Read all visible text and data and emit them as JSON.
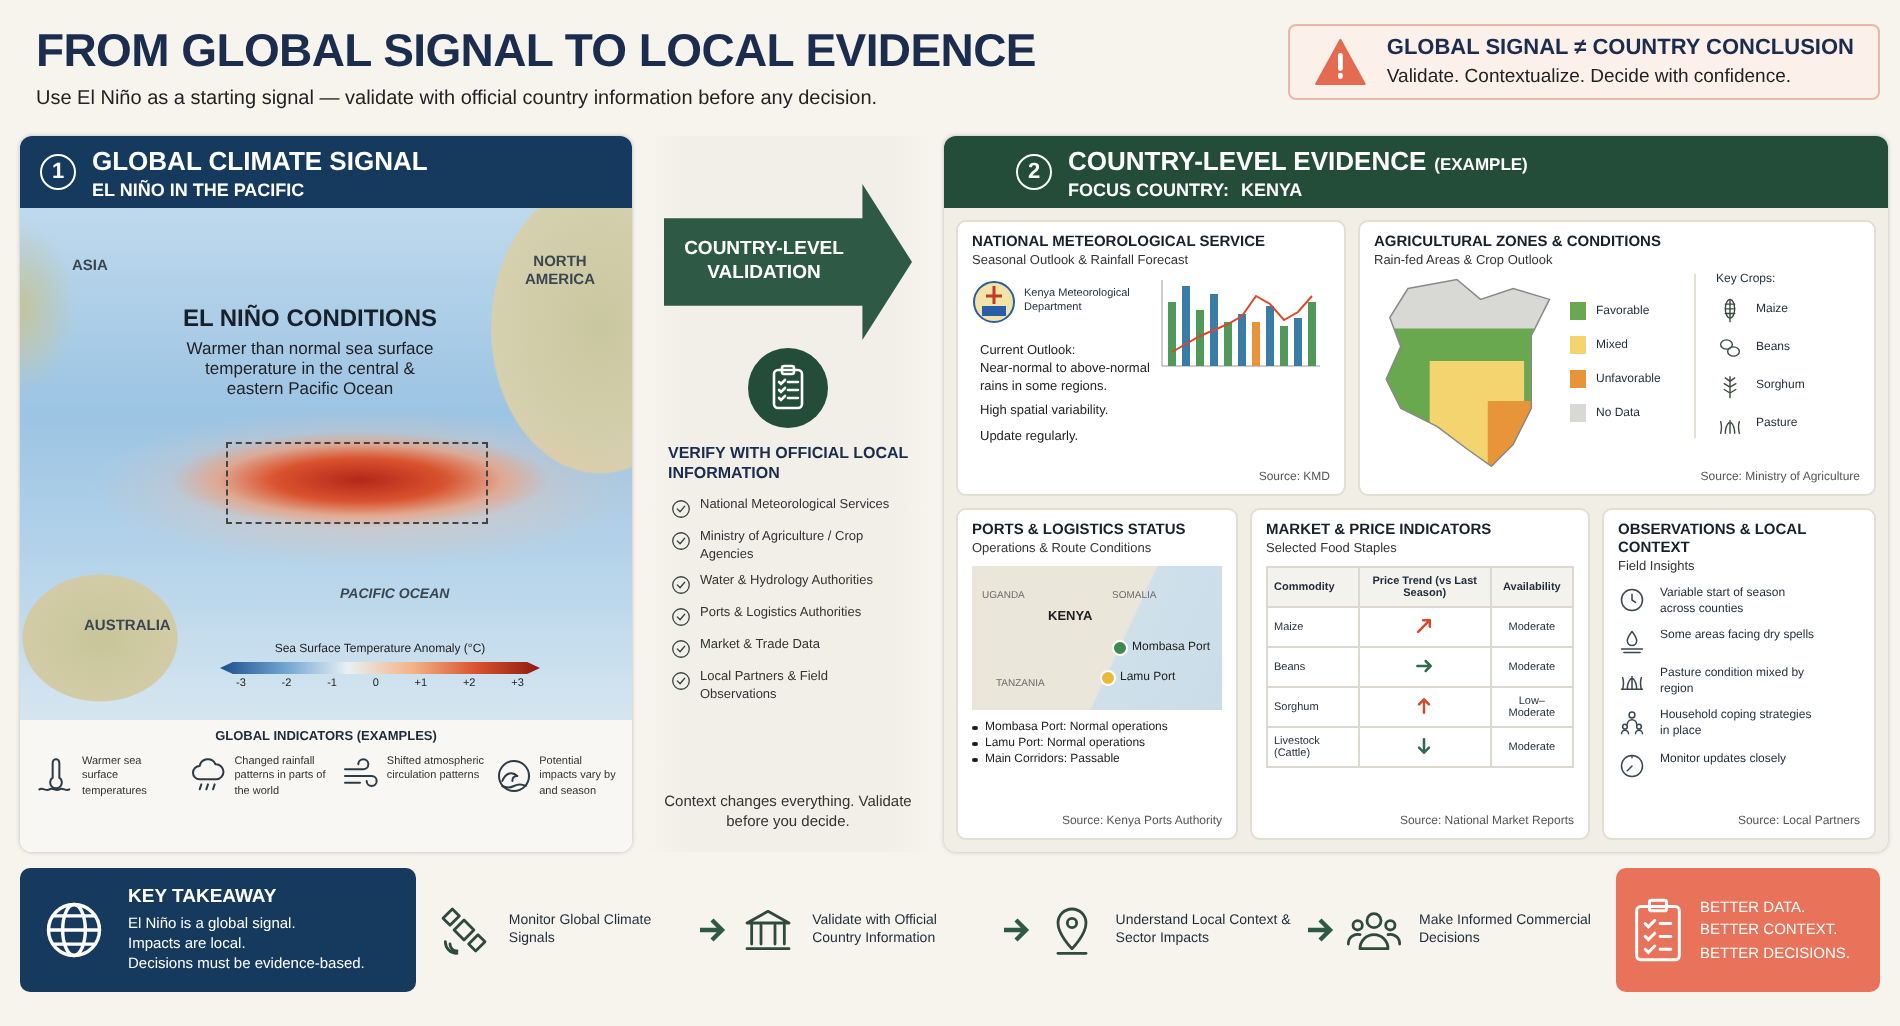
{
  "header": {
    "title": "FROM GLOBAL SIGNAL TO LOCAL EVIDENCE",
    "subtitle": "Use El Niño as a starting signal — validate with official country information before any decision."
  },
  "alert": {
    "title": "GLOBAL SIGNAL ≠ COUNTRY CONCLUSION",
    "text": "Validate. Contextualize. Decide with confidence."
  },
  "global_panel": {
    "number": "1",
    "title": "GLOBAL CLIMATE SIGNAL",
    "subtitle": "EL NIÑO IN THE PACIFIC",
    "map": {
      "asia": "ASIA",
      "north_america": "NORTH AMERICA",
      "australia": "AUSTRALIA",
      "ocean": "PACIFIC OCEAN"
    },
    "callout": {
      "title": "EL NIÑO CONDITIONS",
      "text": "Warmer than normal sea surface temperature in the central & eastern Pacific Ocean"
    },
    "scale": {
      "title": "Sea Surface Temperature Anomaly (°C)",
      "ticks": [
        "-3",
        "-2",
        "-1",
        "0",
        "+1",
        "+2",
        "+3"
      ]
    },
    "indicators": {
      "title": "GLOBAL INDICATORS (EXAMPLES)",
      "items": [
        {
          "kind": "thermometer",
          "text": "Warmer sea surface temperatures"
        },
        {
          "kind": "rain",
          "text": "Changed rainfall patterns in parts of the world"
        },
        {
          "kind": "wind",
          "text": "Shifted atmospheric circulation patterns"
        },
        {
          "kind": "wave",
          "text": "Potential impacts vary by and season"
        }
      ]
    }
  },
  "validation": {
    "arrow_label": "COUNTRY-LEVEL VALIDATION",
    "title": "VERIFY WITH OFFICIAL LOCAL INFORMATION",
    "items": [
      "National Meteorological Services",
      "Ministry of Agriculture / Crop Agencies",
      "Water & Hydrology Authorities",
      "Ports & Logistics Authorities",
      "Market & Trade Data",
      "Local Partners & Field Observations"
    ],
    "footer": "Context changes everything. Validate before you decide."
  },
  "country_panel": {
    "number": "2",
    "title": "COUNTRY-LEVEL EVIDENCE",
    "title_note": "(EXAMPLE)",
    "focus_label": "FOCUS COUNTRY:",
    "focus_country": "KENYA"
  },
  "met": {
    "title": "NATIONAL METEOROLOGICAL SERVICE",
    "subtitle": "Seasonal Outlook & Rainfall Forecast",
    "org": "Kenya Meteorological Department",
    "outlook_label": "Current Outlook:",
    "outlook": "Near-normal to above-normal rains in some regions.",
    "notes": [
      "High spatial variability.",
      "Update regularly."
    ],
    "source": "Source: KMD"
  },
  "agri": {
    "title": "AGRICULTURAL ZONES & CONDITIONS",
    "subtitle": "Rain-fed Areas & Crop Outlook",
    "legend": [
      {
        "label": "Favorable",
        "color": "#6aa84f"
      },
      {
        "label": "Mixed",
        "color": "#f3d46e"
      },
      {
        "label": "Unfavorable",
        "color": "#e8953a"
      },
      {
        "label": "No Data",
        "color": "#d8d8d4"
      }
    ],
    "crops_title": "Key Crops:",
    "crops": [
      {
        "kind": "maize",
        "label": "Maize"
      },
      {
        "kind": "beans",
        "label": "Beans"
      },
      {
        "kind": "sorghum",
        "label": "Sorghum"
      },
      {
        "kind": "pasture",
        "label": "Pasture"
      }
    ],
    "source": "Source: Ministry of Agriculture"
  },
  "ports": {
    "title": "PORTS & LOGISTICS STATUS",
    "subtitle": "Operations & Route Conditions",
    "map": {
      "uganda": "UGANDA",
      "somalia": "SOMALIA",
      "kenya": "KENYA",
      "tanzania": "TANZANIA"
    },
    "ports": [
      {
        "name": "Mombasa Port",
        "color": "#3d8b4f"
      },
      {
        "name": "Lamu Port",
        "color": "#e8b93a"
      }
    ],
    "status": [
      "Mombasa Port: Normal operations",
      "Lamu Port: Normal operations",
      "Main Corridors: Passable"
    ],
    "source": "Source: Kenya Ports Authority"
  },
  "market": {
    "title": "MARKET & PRICE INDICATORS",
    "subtitle": "Selected Food Staples",
    "columns": [
      "Commodity",
      "Price Trend (vs Last Season)",
      "Availability"
    ],
    "rows": [
      {
        "commodity": "Maize",
        "kind": "rising",
        "availability": "Moderate"
      },
      {
        "commodity": "Beans",
        "kind": "steady",
        "availability": "Moderate"
      },
      {
        "commodity": "Sorghum",
        "kind": "up",
        "availability": "Low–Moderate"
      },
      {
        "commodity": "Livestock (Cattle)",
        "kind": "down",
        "availability": "Moderate"
      }
    ],
    "source": "Source: National Market Reports"
  },
  "observations": {
    "title": "OBSERVATIONS & LOCAL CONTEXT",
    "subtitle": "Field Insights",
    "items": [
      {
        "kind": "clock",
        "text": "Variable start of season across counties"
      },
      {
        "kind": "drop",
        "text": "Some areas facing dry spells"
      },
      {
        "kind": "grass",
        "text": "Pasture condition mixed by region"
      },
      {
        "kind": "family",
        "text": "Household coping strategies in place"
      },
      {
        "kind": "gauge",
        "text": "Monitor updates closely"
      }
    ],
    "source": "Source: Local Partners"
  },
  "takeaway": {
    "title": "KEY TAKEAWAY",
    "lines": [
      "El Niño is a global signal.",
      "Impacts are local.",
      "Decisions must be evidence-based."
    ]
  },
  "steps": [
    {
      "kind": "satellite",
      "text": "Monitor Global Climate Signals"
    },
    {
      "kind": "building",
      "text": "Validate with Official Country Information"
    },
    {
      "kind": "pin",
      "text": "Understand Local Context & Sector Impacts"
    },
    {
      "kind": "people",
      "text": "Make Informed Commercial Decisions"
    }
  ],
  "closing": {
    "lines": [
      "BETTER DATA.",
      "BETTER CONTEXT.",
      "BETTER DECISIONS."
    ]
  }
}
